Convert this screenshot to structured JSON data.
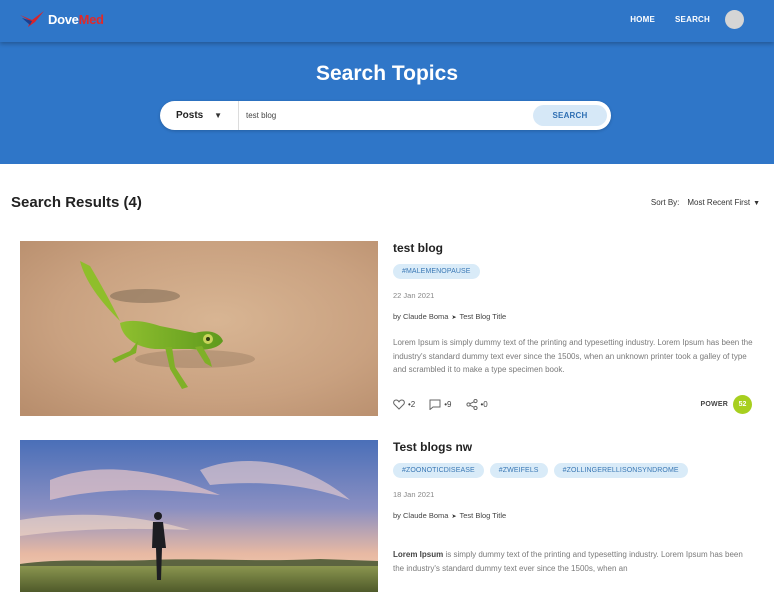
{
  "header": {
    "logo": {
      "part1": "Dove",
      "part2": "Med"
    },
    "nav": {
      "home": "HOME",
      "search": "SEARCH"
    }
  },
  "hero": {
    "title": "Search Topics",
    "select_value": "Posts",
    "select_caret": "▼",
    "query": "test blog",
    "search_button": "SEARCH"
  },
  "results": {
    "title": "Search Results (4)",
    "sort_label": "Sort By:",
    "sort_value": "Most Recent First"
  },
  "posts": [
    {
      "title": "test blog",
      "tags": [
        "#MALEMENOPAUSE"
      ],
      "date": "22 Jan 2021",
      "author": "by Claude Boma",
      "category": "Test Blog Title",
      "excerpt": "Lorem Ipsum is simply dummy text of the printing and typesetting industry. Lorem Ipsum has been the industry's standard dummy text ever since the 1500s, when an unknown printer took a galley of type and scrambled it to make a type specimen book.",
      "likes": "•2",
      "comments": "•9",
      "shares": "•0",
      "power_label": "POWER",
      "power_value": "52"
    },
    {
      "title": "Test blogs nw",
      "tags": [
        "#ZOONOTICDISEASE",
        "#ZWEIFELS",
        "#ZOLLINGERELLISONSYNDROME"
      ],
      "date": "18 Jan 2021",
      "author": "by Claude Boma",
      "category": "Test Blog Title",
      "excerpt_bold": "Lorem Ipsum",
      "excerpt": " is simply dummy text of the printing and typesetting industry. Lorem Ipsum has been the industry's standard dummy text ever since the 1500s, when an"
    }
  ],
  "colors": {
    "brand_blue": "#2f76c8",
    "tag_bg": "#d9ebf8",
    "power_green": "#a7cf1f"
  },
  "icons": [
    "dovemed-logo-icon",
    "heart-icon",
    "comment-icon",
    "share-icon",
    "caret-down-icon"
  ]
}
